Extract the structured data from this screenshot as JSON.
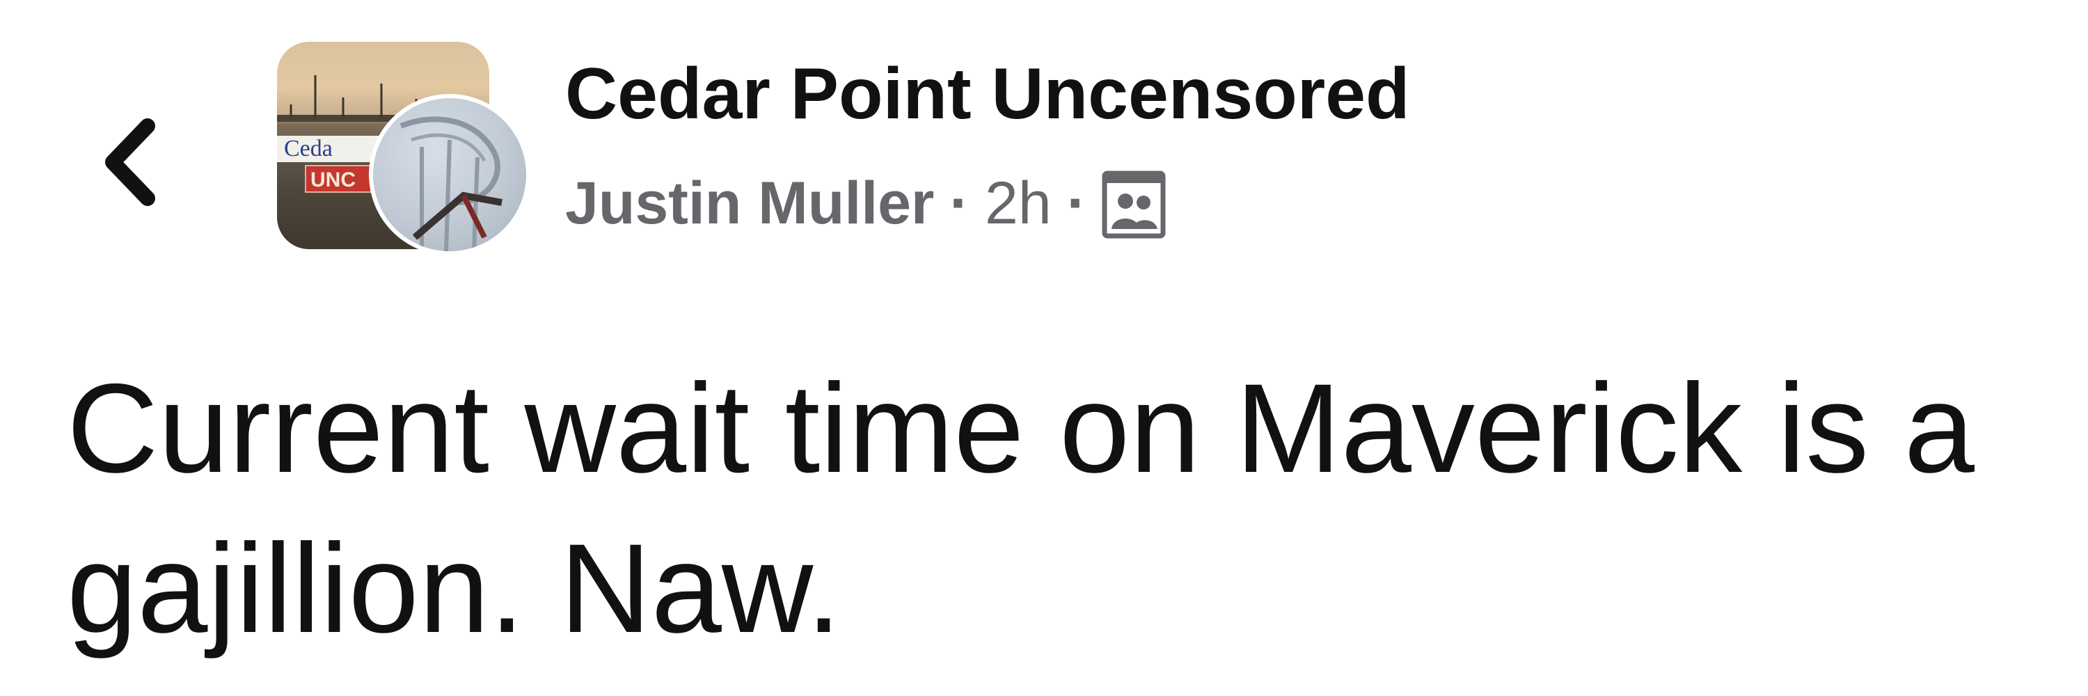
{
  "header": {
    "group_name": "Cedar Point Uncensored",
    "author_name": "Justin Muller",
    "separator": "·",
    "timestamp": "2h",
    "audience_icon": "group-members-icon",
    "back_icon": "chevron-left-icon"
  },
  "group_avatar": {
    "sign_top_text": "Ceda",
    "sign_bottom_text": "UNC"
  },
  "post": {
    "text": "Current wait time on Maverick is a gajillion. Naw."
  },
  "colors": {
    "primary_text": "#111111",
    "secondary_text": "#65676b",
    "background": "#ffffff",
    "sign_red": "#c4362e",
    "sign_blue": "#2a3f8f"
  }
}
